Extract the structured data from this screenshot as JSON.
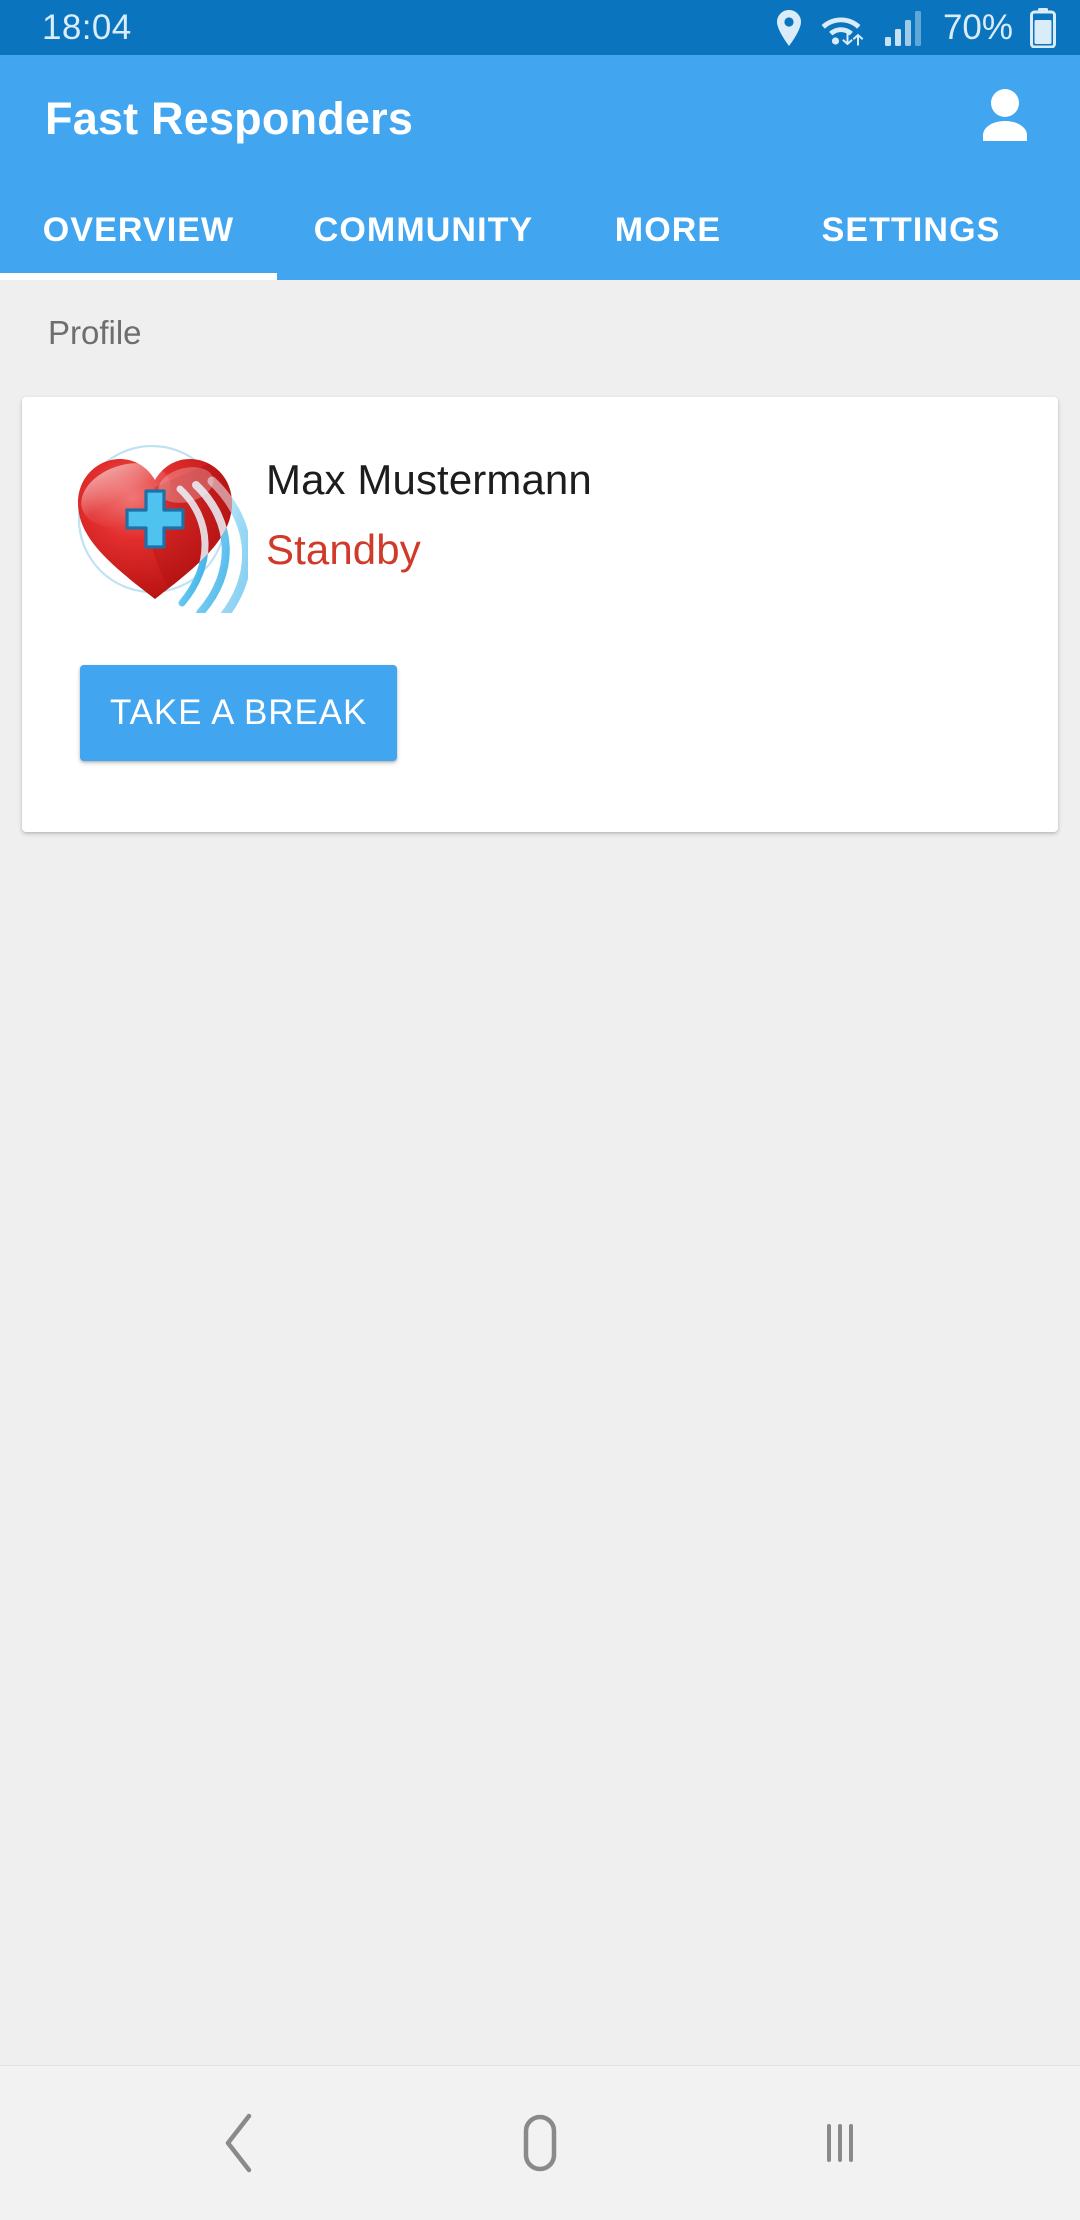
{
  "status_bar": {
    "time": "18:04",
    "battery_percent": "70%",
    "icons": [
      "location-pin-icon",
      "wifi-icon",
      "cellular-signal-icon",
      "battery-icon"
    ],
    "background_color": "#0a74be",
    "text_color": "#d9ecf8"
  },
  "app_bar": {
    "title": "Fast Responders",
    "account_icon": "account-person-icon",
    "background_color": "#42a5ef",
    "text_color": "#ffffff"
  },
  "tabs": {
    "active_index": 0,
    "indicator_color": "#ffffff",
    "items": [
      {
        "label": "OVERVIEW"
      },
      {
        "label": "COMMUNITY"
      },
      {
        "label": "MORE"
      },
      {
        "label": "SETTINGS"
      }
    ]
  },
  "content": {
    "section_label": "Profile",
    "background_color": "#efefef",
    "profile_card": {
      "logo_icon": "heart-pulse-logo-icon",
      "name": "Max Mustermann",
      "status": "Standby",
      "status_color": "#d03a2a",
      "name_color": "#1d1d1d",
      "action_button": {
        "label": "TAKE A BREAK",
        "background_color": "#42a5ef",
        "text_color": "#ffffff"
      }
    }
  },
  "nav_bar": {
    "background_color": "#f2f2f2",
    "icon_color": "#8a8a8a",
    "buttons": [
      {
        "name": "back-icon"
      },
      {
        "name": "home-icon"
      },
      {
        "name": "recents-icon"
      }
    ]
  }
}
